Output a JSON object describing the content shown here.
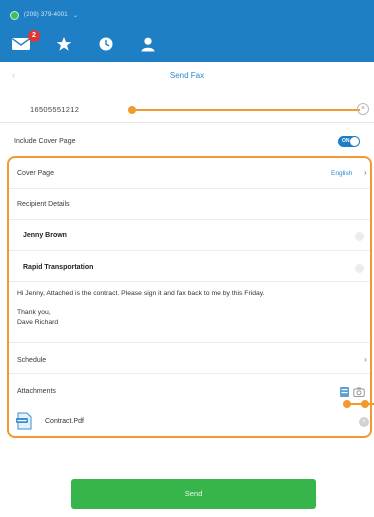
{
  "status": {
    "phone": "(209) 379-4001",
    "caret": "⌄"
  },
  "nav": {
    "messages_badge": "2"
  },
  "header": {
    "back_glyph": "‹",
    "title": "Send Fax"
  },
  "fax": {
    "number": "16505551212",
    "clear_glyph": "×"
  },
  "cover_toggle": {
    "label": "Include Cover Page",
    "state_text": "ON"
  },
  "cover_page": {
    "label": "Cover Page",
    "language": "English",
    "chevron": "›",
    "recipient_header": "Recipient Details",
    "recipient_name": "Jenny Brown",
    "company": "Rapid Transportation",
    "message_line": "Hi Jenny, Attached is the contract. Please sign it and fax back to me by this Friday.",
    "signoff": "Thank you,",
    "sender": "Dave Richard"
  },
  "schedule": {
    "label": "Schedule",
    "chevron": "›"
  },
  "attachments": {
    "label": "Attachments",
    "files": [
      {
        "name": "Contract.Pdf",
        "remove_glyph": "×"
      }
    ]
  },
  "actions": {
    "send_label": "Send"
  },
  "colors": {
    "brand": "#1f7fc4",
    "accent": "#2a8ad0",
    "callout": "#f29a2e",
    "send": "#38b54a",
    "badge": "#e03535"
  },
  "icons": [
    "message-icon",
    "star-icon",
    "clock-icon",
    "contact-icon",
    "pdf-file-icon",
    "scanner-icon",
    "camera-icon"
  ]
}
